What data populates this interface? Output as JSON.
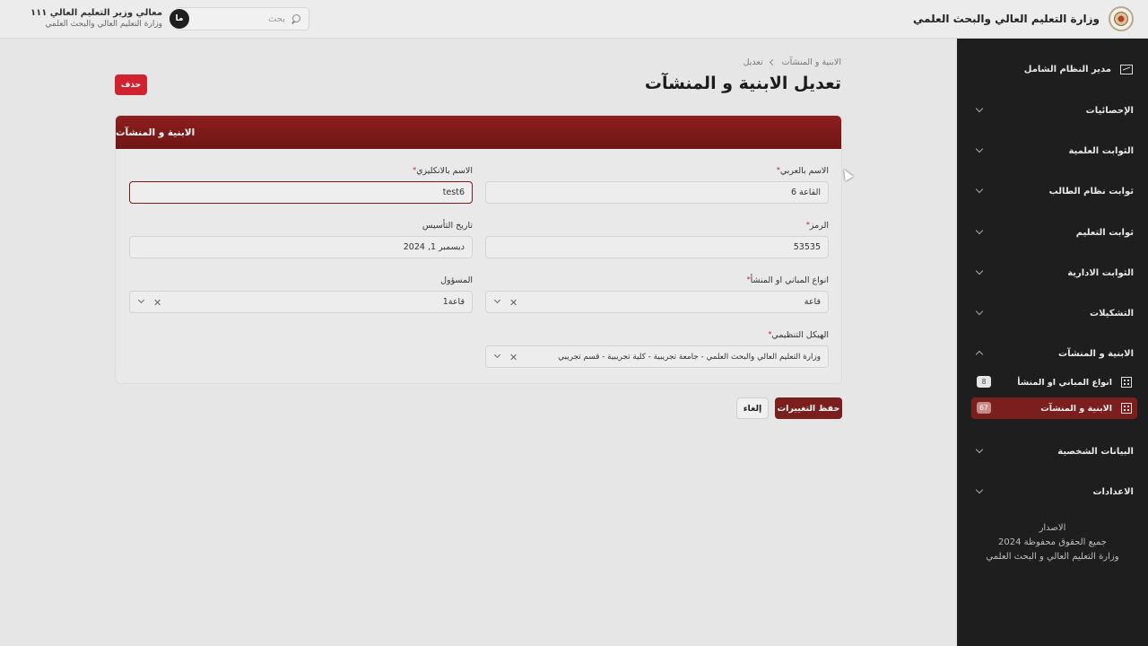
{
  "header": {
    "brand_title": "وزارة التعليم العالي والبحث العلمي",
    "search_placeholder": "بحث",
    "user": {
      "avatar_initials": "ما",
      "name": "معالي وزير التعليم العالي ١١١",
      "org": "وزارة التعليم العالي والبحث العلمي"
    }
  },
  "sidebar": {
    "top_item": "مدير النظام الشامل",
    "items": [
      {
        "label": "الإحصائيات"
      },
      {
        "label": "الثوابت العلمية"
      },
      {
        "label": "ثوابت نظام الطالب"
      },
      {
        "label": "ثوابت التعليم"
      },
      {
        "label": "الثوابت الادارية"
      },
      {
        "label": "التشكيلات"
      },
      {
        "label": "الابنية و المنشآت"
      },
      {
        "label": "البيانات الشخصية"
      },
      {
        "label": "الاعدادات"
      }
    ],
    "sub_items": [
      {
        "label": "انواع المباني او المنشأ",
        "count": "8"
      },
      {
        "label": "الابنية و المنشآت",
        "count": "67"
      }
    ],
    "footer": {
      "line1": "الاصدار",
      "line2": "جميع الحقوق محفوظة 2024",
      "line3": "وزارة التعليم العالي و البحث العلمي"
    }
  },
  "main": {
    "breadcrumb": [
      "الابنية و المنشآت",
      "تعديل"
    ],
    "title": "تعديل الابنية و المنشآت",
    "delete_label": "حذف",
    "card_title": "الابنية و المنشآت",
    "fields": {
      "name_ar": {
        "label": "الاسم بالعربي",
        "value": "القاعة 6"
      },
      "name_en": {
        "label": "الاسم بالانكليزي",
        "value": "test6"
      },
      "code": {
        "label": "الرمز",
        "value": "53535"
      },
      "founded": {
        "label": "تاريخ التأسيس",
        "value": "ديسمبر 1, 2024"
      },
      "building_type": {
        "label": "انواع المباني او المنشأ",
        "value": "قاعة"
      },
      "responsible": {
        "label": "المسؤول",
        "value": "قاعة1"
      },
      "org_structure": {
        "label": "الهيكل التنظيمي",
        "value": "وزارة التعليم العالي والبحث العلمي - جامعة تجريبية - كلية تجريبية - قسم تجريبي"
      }
    },
    "required_mark": "*",
    "save_label": "حفظ التغييرات",
    "cancel_label": "إلغاء"
  }
}
